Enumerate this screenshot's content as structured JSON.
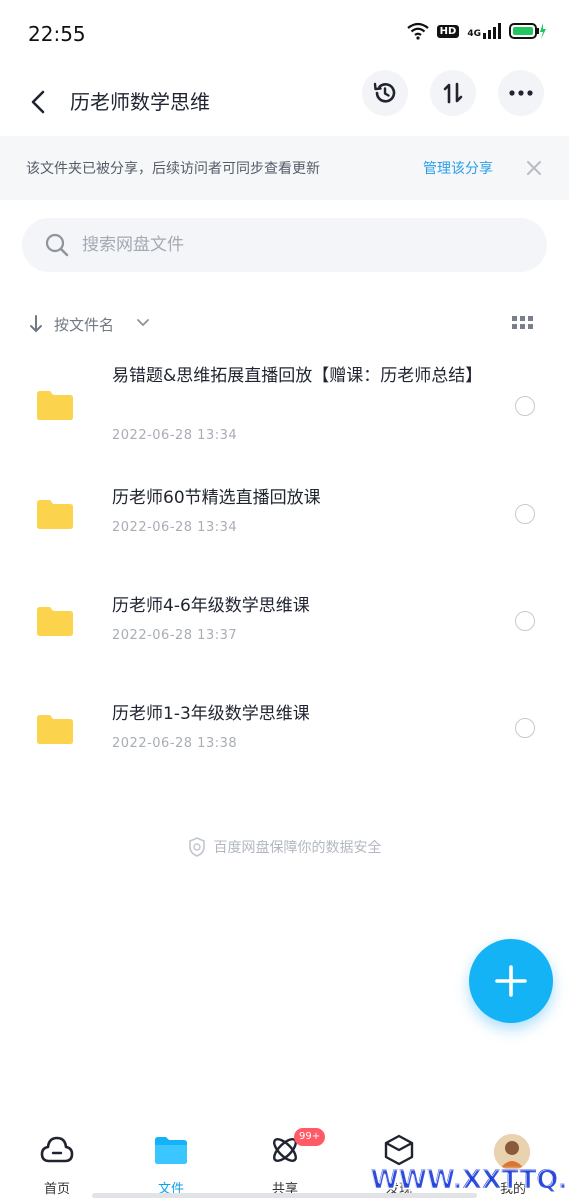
{
  "status_bar": {
    "time": "22:55",
    "hd": "HD",
    "network": "4G"
  },
  "header": {
    "title": "历老师数学思维"
  },
  "notice": {
    "text": "该文件夹已被分享，后续访问者可同步查看更新",
    "link": "管理该分享"
  },
  "search": {
    "placeholder": "搜索网盘文件"
  },
  "sort": {
    "label": "按文件名"
  },
  "files": [
    {
      "name": "易错题&思维拓展直播回放【赠课：历老师总结】",
      "date": "2022-06-28  13:34"
    },
    {
      "name": "历老师60节精选直播回放课",
      "date": "2022-06-28  13:34"
    },
    {
      "name": "历老师4-6年级数学思维课",
      "date": "2022-06-28  13:37"
    },
    {
      "name": "历老师1-3年级数学思维课",
      "date": "2022-06-28  13:38"
    }
  ],
  "safety_text": "百度网盘保障你的数据安全",
  "bottom_nav": {
    "items": [
      {
        "label": "首页"
      },
      {
        "label": "文件"
      },
      {
        "label": "共享",
        "badge": "99+"
      },
      {
        "label": "发现"
      },
      {
        "label": "我的"
      }
    ],
    "active_index": 1
  },
  "watermark": "www.xxttq.com",
  "colors": {
    "accent": "#14b3f5",
    "folder": "#fcd34d",
    "link": "#2a9fe8",
    "badge": "#ff5a66"
  }
}
